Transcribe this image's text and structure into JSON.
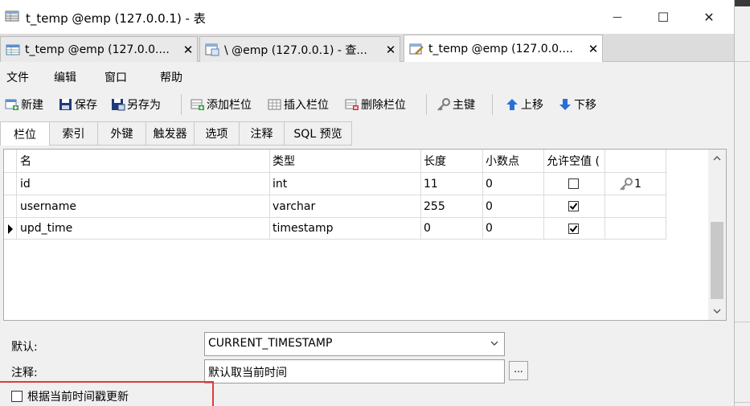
{
  "window": {
    "title": "t_temp @emp (127.0.0.1) - 表",
    "minimize_glyph": "—",
    "maximize_glyph": "☐",
    "close_glyph": "✕"
  },
  "tabs": [
    {
      "label": "t_temp @emp (127.0.0....",
      "icon": "table-icon",
      "close": "✕"
    },
    {
      "label": "\\ @emp (127.0.0.1) - 查...",
      "icon": "query-icon",
      "close": "✕"
    },
    {
      "label": "t_temp @emp (127.0.0....",
      "icon": "design-table-icon",
      "close": "✕",
      "active": true
    }
  ],
  "menu": [
    "文件",
    "编辑",
    "窗口",
    "帮助"
  ],
  "toolbar": {
    "new": "新建",
    "save": "保存",
    "save_as": "另存为",
    "add_field": "添加栏位",
    "insert_field": "插入栏位",
    "delete_field": "删除栏位",
    "primary_key": "主键",
    "move_up": "上移",
    "move_down": "下移"
  },
  "subtabs": [
    "栏位",
    "索引",
    "外键",
    "触发器",
    "选项",
    "注释",
    "SQL 预览"
  ],
  "grid": {
    "headers": [
      "名",
      "类型",
      "长度",
      "小数点",
      "允许空值 ("
    ],
    "rows": [
      {
        "name": "id",
        "type": "int",
        "length": "11",
        "decimals": "0",
        "nullable": false,
        "key": "1",
        "current": false
      },
      {
        "name": "username",
        "type": "varchar",
        "length": "255",
        "decimals": "0",
        "nullable": true,
        "key": "",
        "current": false
      },
      {
        "name": "upd_time",
        "type": "timestamp",
        "length": "0",
        "decimals": "0",
        "nullable": true,
        "key": "",
        "current": true
      }
    ]
  },
  "properties": {
    "default_label": "默认:",
    "default_value": "CURRENT_TIMESTAMP",
    "comment_label": "注释:",
    "comment_value": "默认取当前时间",
    "more_label": "...",
    "update_label": "根据当前时间戳更新"
  },
  "colors": {
    "highlight": "#e03a3a",
    "arrow_blue": "#2a6fd6"
  }
}
